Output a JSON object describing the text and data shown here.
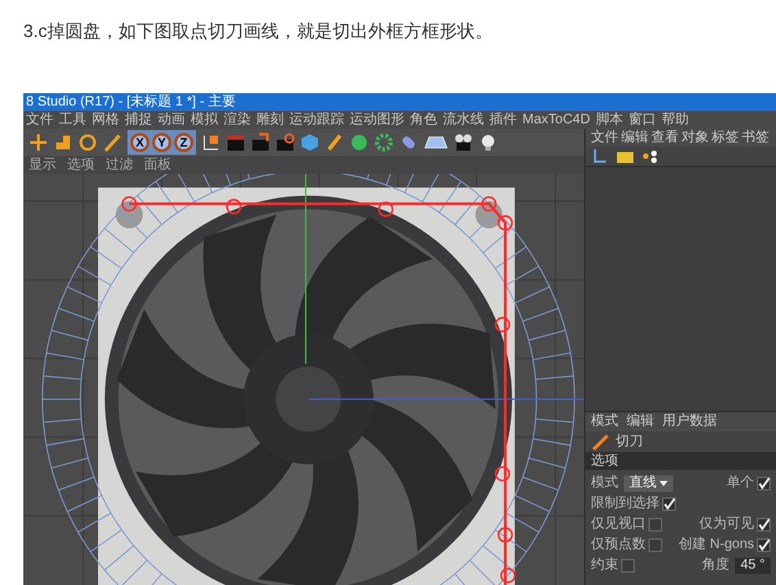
{
  "instruction": "3.c掉圆盘，如下图取点切刀画线，就是切出外框方框形状。",
  "app": {
    "title": "8 Studio (R17) - [未标题 1 *] - 主要",
    "menu": [
      "文件",
      "工具",
      "网格",
      "捕捉",
      "动画",
      "模拟",
      "渲染",
      "雕刻",
      "运动跟踪",
      "运动图形",
      "角色",
      "流水线",
      "插件",
      "MaxToC4D",
      "脚本",
      "窗口",
      "帮助"
    ],
    "axis_buttons": [
      {
        "label": "X",
        "selected": true
      },
      {
        "label": "Y",
        "selected": true
      },
      {
        "label": "Z",
        "selected": true
      }
    ],
    "viewport_menu": [
      "显示",
      "选项",
      "过滤",
      "面板"
    ],
    "objects_menu": [
      "文件",
      "编辑",
      "查看",
      "对象",
      "标签",
      "书签"
    ],
    "attributes": {
      "tabs": [
        "模式",
        "编辑",
        "用户数据"
      ],
      "tool": "切刀",
      "section": "选项",
      "rows": [
        [
          {
            "kind": "select",
            "label": "模式",
            "value": "直线"
          },
          {
            "kind": "check",
            "label": "单个",
            "checked": true
          }
        ],
        [
          {
            "kind": "check",
            "label": "限制到选择",
            "checked": true
          }
        ],
        [
          {
            "kind": "check",
            "label": "仅见视口",
            "checked": false
          },
          {
            "kind": "check",
            "label": "仅为可见",
            "checked": true
          }
        ],
        [
          {
            "kind": "check",
            "label": "仅预点数",
            "checked": false
          },
          {
            "kind": "check",
            "label": "创建 N-gons",
            "checked": true
          }
        ],
        [
          {
            "kind": "check",
            "label": "约束",
            "checked": false
          },
          {
            "kind": "number",
            "label": "角度",
            "value": "45 °"
          }
        ]
      ]
    }
  }
}
